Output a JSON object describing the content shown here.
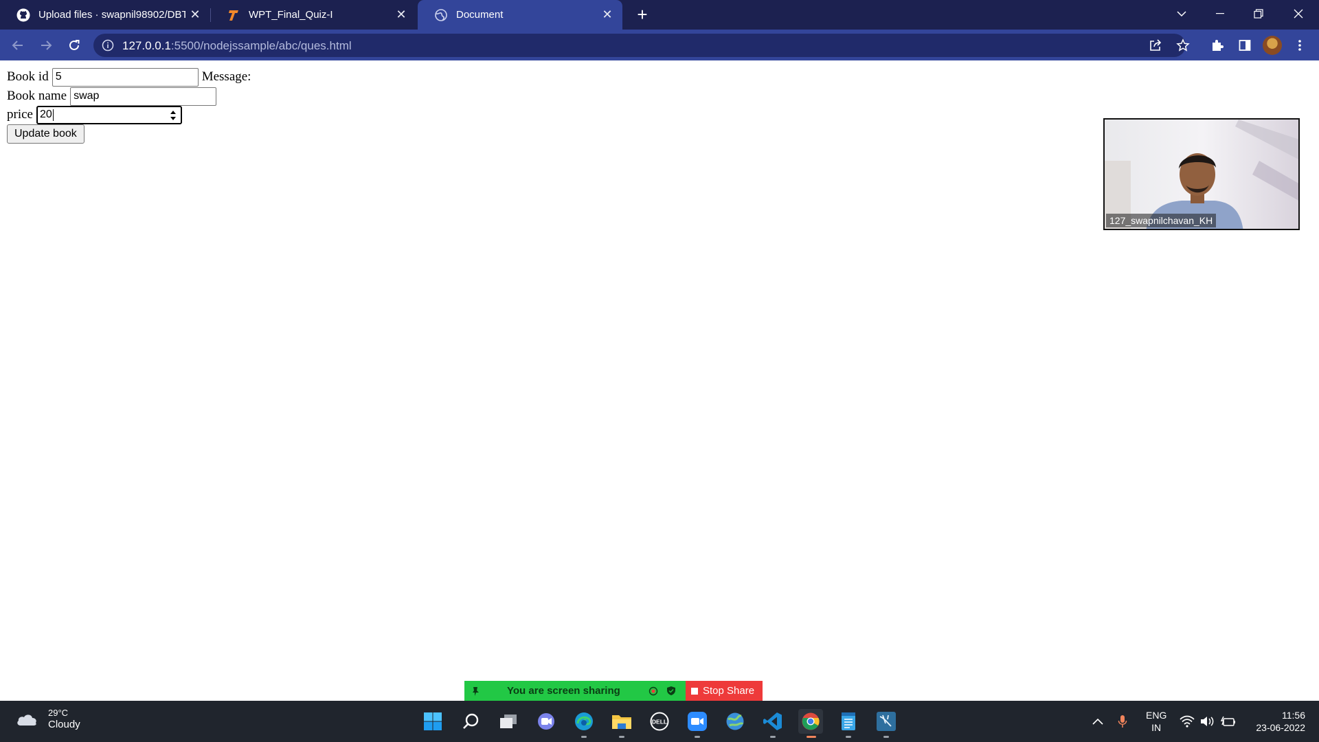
{
  "browser": {
    "tabs": [
      {
        "title": "Upload files · swapnil98902/DBT...",
        "icon": "github-icon",
        "active": false
      },
      {
        "title": "WPT_Final_Quiz-I",
        "icon": "testbook-icon",
        "active": false
      },
      {
        "title": "Document",
        "icon": "globe-icon",
        "active": true
      }
    ],
    "url_host": "127.0.0.1",
    "url_path": ":5500/nodejssample/abc/ques.html",
    "colors": {
      "tabstrip": "#1c2150",
      "toolbar": "#33459a",
      "omnibox": "#202a6a"
    }
  },
  "form": {
    "book_id_label": "Book id",
    "book_id_value": "5",
    "message_label": "Message:",
    "book_name_label": "Book name",
    "book_name_value": "swap",
    "price_label": "price",
    "price_value": "20",
    "update_button": "Update book"
  },
  "video": {
    "participant_name": "127_swapnilchavan_KH"
  },
  "screen_share": {
    "message": "You are screen sharing",
    "stop_label": "Stop Share",
    "colors": {
      "banner": "#22c845",
      "stop": "#ee3a3a"
    }
  },
  "taskbar": {
    "temperature": "29°C",
    "weather": "Cloudy",
    "language_line1": "ENG",
    "language_line2": "IN",
    "time": "11:56",
    "date": "23-06-2022",
    "apps": [
      "start-icon",
      "search-icon",
      "task-view-icon",
      "teams-chat-icon",
      "edge-icon",
      "file-explorer-icon",
      "dell-icon",
      "zoom-icon",
      "browser-icon",
      "vscode-icon",
      "chrome-icon",
      "notepad-icon",
      "workbench-icon"
    ]
  }
}
